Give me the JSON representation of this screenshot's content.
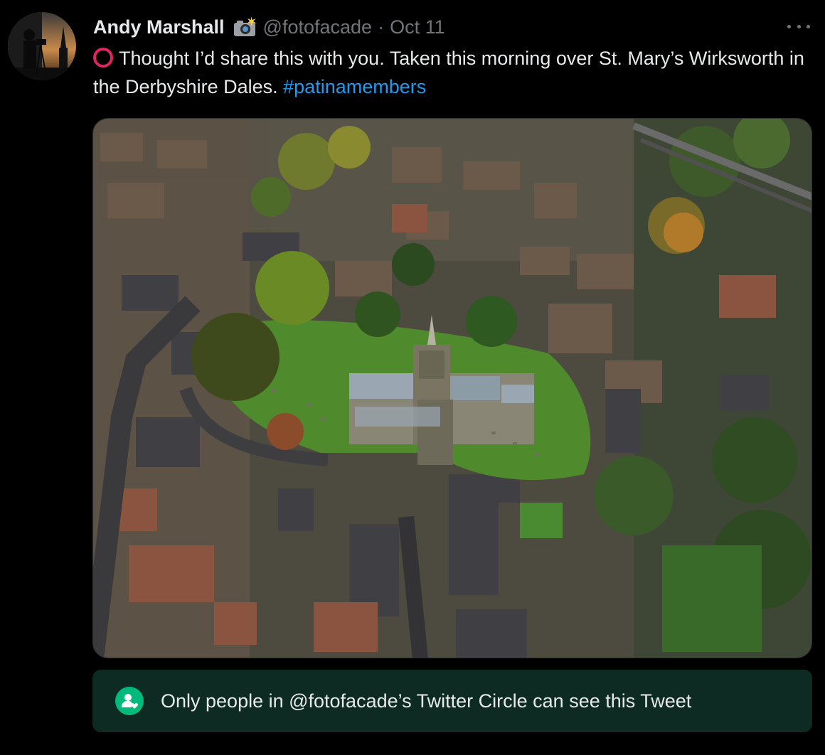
{
  "author": {
    "name": "Andy Marshall",
    "badge_icon": "camera-flash-icon",
    "handle": "@fotofacade",
    "separator": "·",
    "date": "Oct 11"
  },
  "tweet": {
    "lead_icon": "red-circle-icon",
    "text": "Thought I’d share this with you. Taken this morning over St. Mary’s Wirksworth in the Derbyshire Dales.",
    "hashtag": "#patinamembers"
  },
  "media": {
    "icon": "photo-aerial-church"
  },
  "circle_notice": {
    "icon": "twitter-circle-icon",
    "text": "Only people in @fotofacade’s Twitter Circle can see this Tweet"
  },
  "colors": {
    "background": "#000000",
    "text": "#e7e9ea",
    "secondary": "#71767b",
    "link": "#1d9bf0",
    "circle_green": "#00ba7c",
    "banner_bg": "#0d2b22",
    "red_circle": "#e0245e"
  }
}
